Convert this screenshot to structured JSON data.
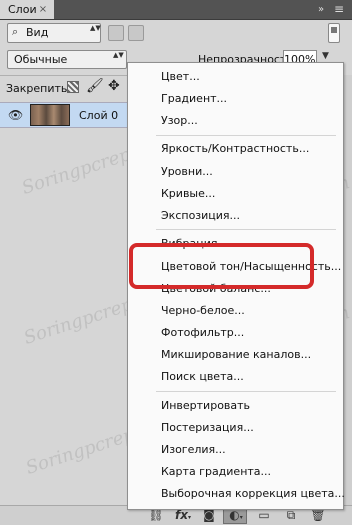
{
  "panel": {
    "tab_label": "Слои",
    "tab_close": "×",
    "collapse_icon": "»",
    "menu_icon": "≡"
  },
  "filter": {
    "kind_label": "Вид",
    "search_icon": "⌕",
    "arrows": "▲▼"
  },
  "blend": {
    "mode": "Обычные",
    "arrows": "▲▼",
    "opacity_label": "Непрозрачность:",
    "opacity_value": "100%",
    "opacity_arrow": "▼"
  },
  "lock": {
    "label": "Закрепить:",
    "brush_icon": "🖌",
    "move_icon": "✥"
  },
  "layer": {
    "eye_icon": "👁",
    "name": "Слой 0"
  },
  "menu": {
    "items": [
      "Цвет...",
      "Градиент...",
      "Узор...",
      "Яркость/Контрастность...",
      "Уровни...",
      "Кривые...",
      "Экспозиция...",
      "Вибрация",
      "Цветовой тон/Насыщенность...",
      "Цветовой баланс...",
      "Черно-белое...",
      "Фотофильтр...",
      "Микширование каналов...",
      "Поиск цвета...",
      "Инвертировать",
      "Постеризация...",
      "Изогелия...",
      "Карта градиента...",
      "Выборочная коррекция цвета..."
    ]
  },
  "bottom_bar": {
    "link_icon": "⛓",
    "fx_icon": "fx",
    "fx_chevron": "▾",
    "mask_icon": "◙",
    "adjustment_icon": "◐",
    "adjustment_chevron": "▾",
    "group_icon": "▭",
    "new_layer_icon": "⧉",
    "trash_icon": "🗑"
  },
  "watermark": "Soringpcrepair.Com",
  "colors": {
    "highlight": "#d42a2a",
    "selected_layer": "#c3d9f2"
  }
}
